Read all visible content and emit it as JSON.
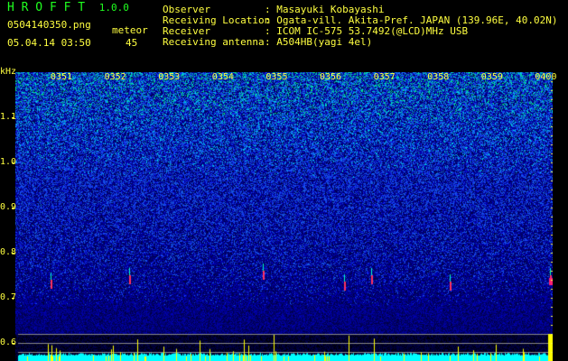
{
  "app": {
    "name": "H R O F F T",
    "version": "1.0.0"
  },
  "file": {
    "name": "0504140350.png",
    "datetime": "05.04.14 03:50"
  },
  "meteor": {
    "label": "meteor",
    "count": "45"
  },
  "info": [
    {
      "label": "Observer",
      "value": ": Masayuki Kobayashi"
    },
    {
      "label": "Receiving Location",
      "value": ": Ogata-vill. Akita-Pref. JAPAN (139.96E, 40.02N)"
    },
    {
      "label": "Receiver",
      "value": ": ICOM IC-575 53.7492(@LCD)MHz USB"
    },
    {
      "label": "Receiving antenna",
      "value": ": A504HB(yagi 4el)"
    }
  ],
  "axis": {
    "unit": "kHz",
    "freq_labels": [
      "1.1",
      "1.0",
      "0.9",
      "0.8",
      "0.7",
      "0.6"
    ],
    "time_labels": [
      "0351",
      "0352",
      "0353",
      "0354",
      "0355",
      "0356",
      "0357",
      "0358",
      "0359",
      "0400"
    ]
  },
  "colors": {
    "text": "#ffff40",
    "title": "#20ff20",
    "signal": "#00ffff",
    "spike": "#ffff00"
  }
}
